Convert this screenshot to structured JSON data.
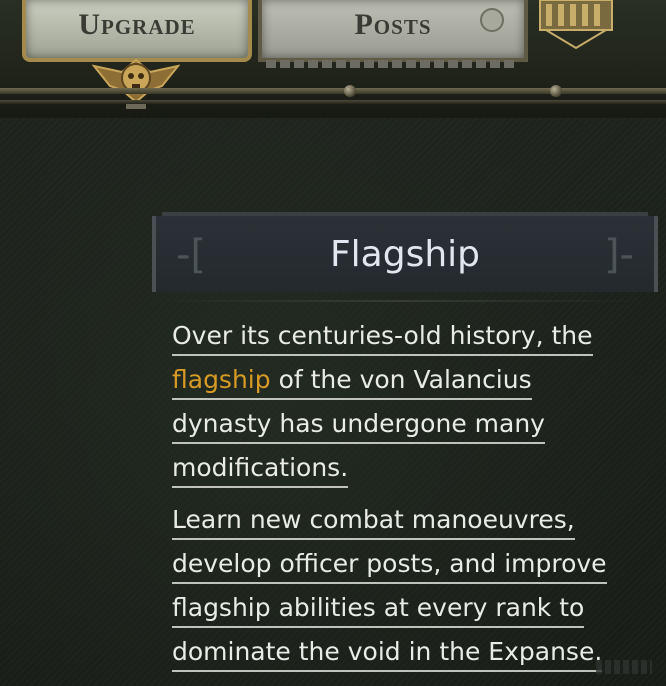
{
  "tabs": [
    {
      "label": "Upgrade",
      "active": true
    },
    {
      "label": "Posts",
      "active": false
    }
  ],
  "panel": {
    "title": "Flagship",
    "paragraph1": {
      "line1": "Over its centuries-old history, the",
      "line2_highlight": "flagship",
      "line2_rest": " of the von Valancius",
      "line3": "dynasty has undergone many",
      "line4": "modifications."
    },
    "paragraph2": {
      "line1": "Learn new combat manoeuvres,",
      "line2": "develop officer posts, and improve",
      "line3": "flagship abilities at every rank to",
      "line4": "dominate the void in the Expanse."
    }
  },
  "colors": {
    "highlight": "#d69a25",
    "text": "#e9ebe6",
    "title": "#e2e6ee"
  },
  "icons": {
    "emblem": "skull-eagle-icon",
    "ornament": "gear-ornament-icon"
  }
}
